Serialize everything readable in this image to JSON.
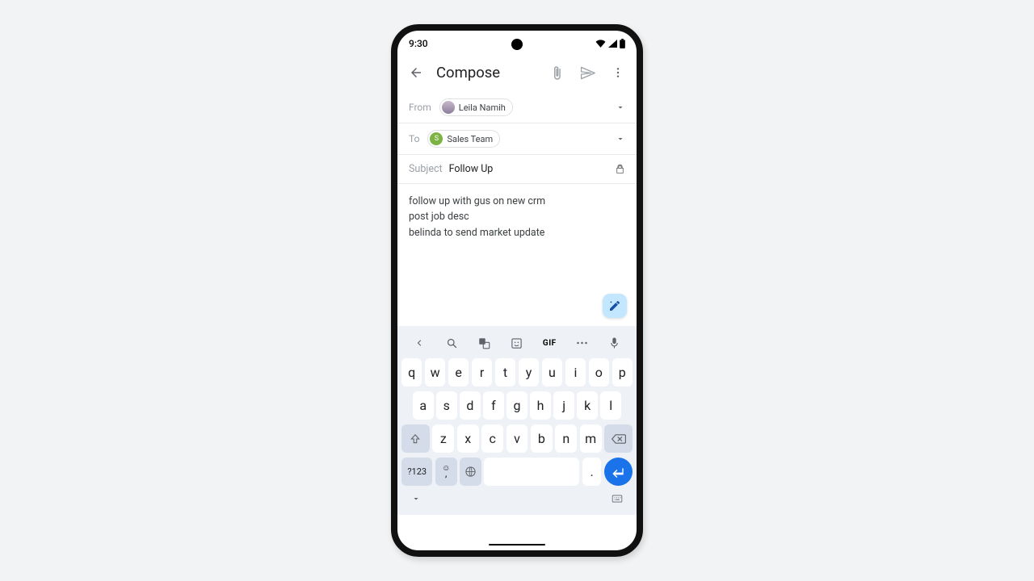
{
  "status": {
    "time": "9:30"
  },
  "appbar": {
    "title": "Compose"
  },
  "fields": {
    "from_label": "From",
    "from_name": "Leila Namih",
    "to_label": "To",
    "to_name": "Sales Team",
    "to_initial": "S"
  },
  "subject": {
    "label": "Subject",
    "value": "Follow Up"
  },
  "body": "follow up with gus on new crm\npost job desc\nbelinda to send market update",
  "keyboard": {
    "row1": [
      "q",
      "w",
      "e",
      "r",
      "t",
      "y",
      "u",
      "i",
      "o",
      "p"
    ],
    "row2": [
      "a",
      "s",
      "d",
      "f",
      "g",
      "h",
      "j",
      "k",
      "l"
    ],
    "row3": [
      "z",
      "x",
      "c",
      "v",
      "b",
      "n",
      "m"
    ],
    "symbols": "?123",
    "period": ".",
    "gif": "GIF",
    "comma_emoji": ","
  }
}
